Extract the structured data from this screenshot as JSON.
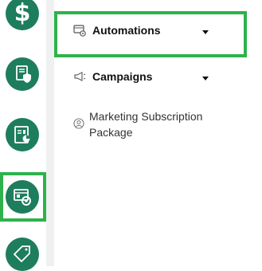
{
  "rail": {
    "items": [
      {
        "name": "billing",
        "icon": "dollar-icon",
        "glyph": "$"
      },
      {
        "name": "documents",
        "icon": "shield-document-icon"
      },
      {
        "name": "reports",
        "icon": "report-chart-icon"
      },
      {
        "name": "marketing",
        "icon": "automation-icon",
        "selected": true
      },
      {
        "name": "offers",
        "icon": "tag-icon"
      }
    ],
    "accent": "#1e7d5c",
    "highlight": "#2eb24b"
  },
  "submenu": {
    "automations": {
      "label": "Automations",
      "icon": "automation-icon"
    },
    "campaigns": {
      "label": "Campaigns",
      "icon": "megaphone-icon"
    },
    "subscription": {
      "label": "Marketing Subscription Package",
      "icon": "user-circle-icon"
    }
  }
}
